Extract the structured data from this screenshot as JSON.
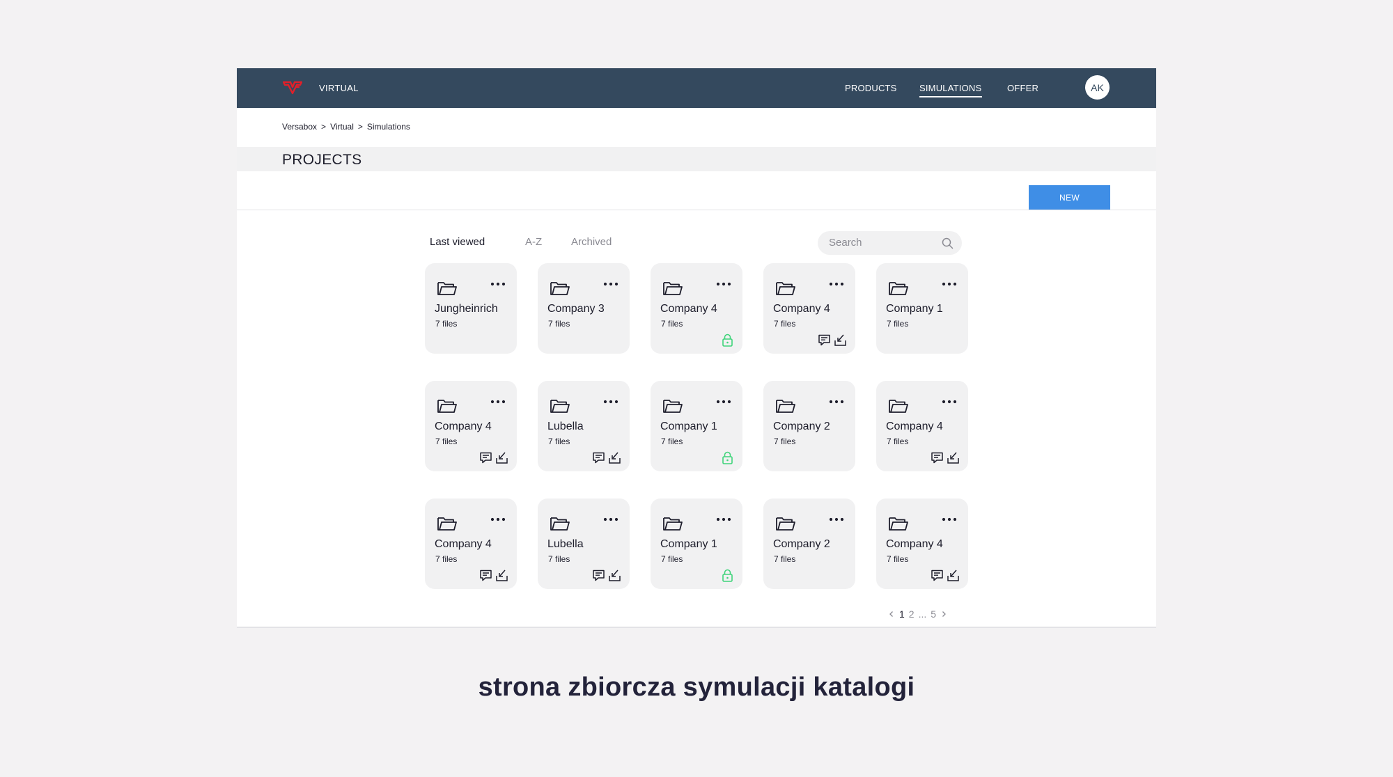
{
  "header": {
    "brand": "VIRTUAL",
    "nav": [
      "PRODUCTS",
      "SIMULATIONS",
      "OFFER"
    ],
    "active_nav": "SIMULATIONS",
    "avatar_initials": "AK",
    "logo_color": "#e0202a",
    "bar_color": "#34495e"
  },
  "breadcrumb": {
    "items": [
      "Versabox",
      "Virtual",
      "Simulations"
    ],
    "separator": ">"
  },
  "page_title": "PROJECTS",
  "new_button": "NEW",
  "tabs": [
    "Last viewed",
    "A-Z",
    "Archived"
  ],
  "active_tab": "Last viewed",
  "search": {
    "placeholder": "Search",
    "value": ""
  },
  "cards": [
    {
      "name": "Jungheinrich",
      "files": "7 files",
      "badges": []
    },
    {
      "name": "Company 3",
      "files": "7 files",
      "badges": []
    },
    {
      "name": "Company 4",
      "files": "7 files",
      "badges": [
        "lock"
      ]
    },
    {
      "name": "Company 4",
      "files": "7 files",
      "badges": [
        "comment",
        "download"
      ]
    },
    {
      "name": "Company 1",
      "files": "7 files",
      "badges": []
    },
    {
      "name": "Company 4",
      "files": "7 files",
      "badges": [
        "comment",
        "download"
      ]
    },
    {
      "name": "Lubella",
      "files": "7 files",
      "badges": [
        "comment",
        "download"
      ]
    },
    {
      "name": "Company 1",
      "files": "7 files",
      "badges": [
        "lock"
      ]
    },
    {
      "name": "Company 2",
      "files": "7 files",
      "badges": []
    },
    {
      "name": "Company 4",
      "files": "7 files",
      "badges": [
        "comment",
        "download"
      ]
    },
    {
      "name": "Company 4",
      "files": "7 files",
      "badges": [
        "comment",
        "download"
      ]
    },
    {
      "name": "Lubella",
      "files": "7 files",
      "badges": [
        "comment",
        "download"
      ]
    },
    {
      "name": "Company 1",
      "files": "7 files",
      "badges": [
        "lock"
      ]
    },
    {
      "name": "Company 2",
      "files": "7 files",
      "badges": []
    },
    {
      "name": "Company 4",
      "files": "7 files",
      "badges": [
        "comment",
        "download"
      ]
    }
  ],
  "pagination": {
    "current": "1",
    "pages": [
      "1",
      "2",
      "...",
      "5"
    ]
  },
  "caption": "strona zbiorcza symulacji katalogi",
  "colors": {
    "accent": "#3f8ee6",
    "lock": "#3fd47a",
    "card_bg": "#f1f1f2"
  }
}
